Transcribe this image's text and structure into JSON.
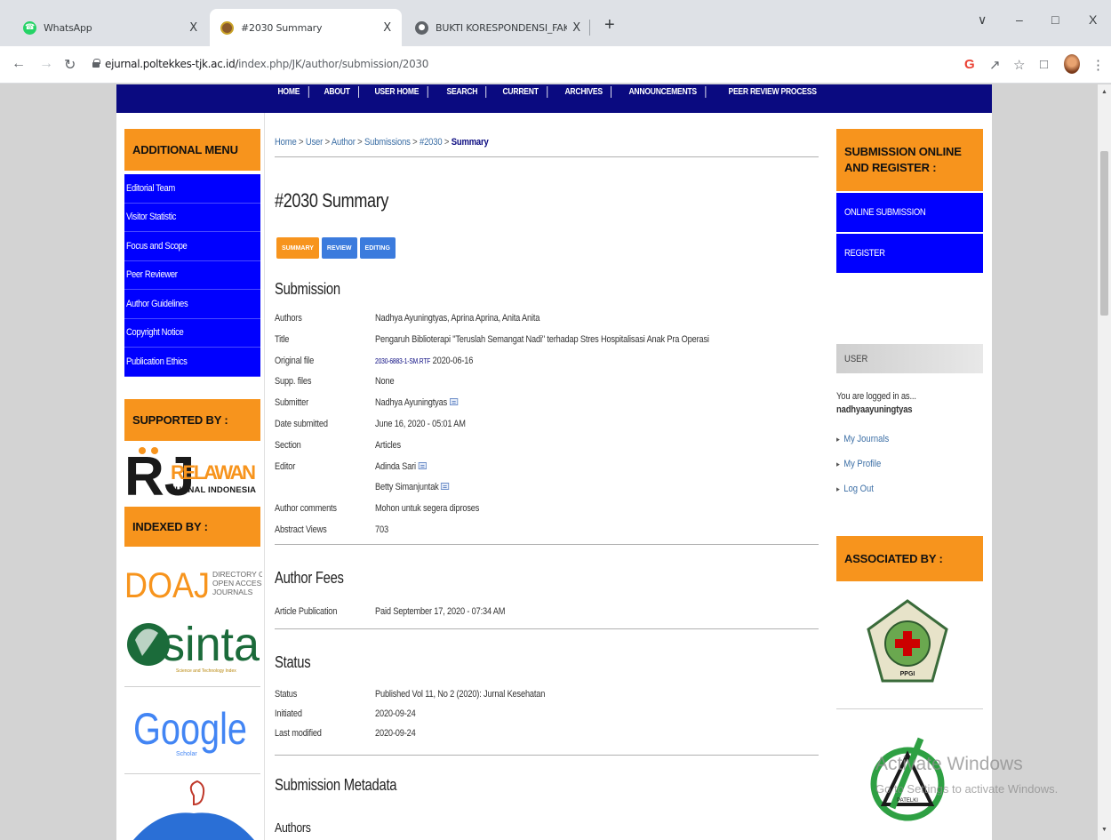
{
  "browser": {
    "tabs": [
      {
        "title": "WhatsApp",
        "close": "X",
        "icon": "whatsapp-icon"
      },
      {
        "title": "#2030 Summary",
        "close": "X",
        "icon": "site-favicon-icon"
      },
      {
        "title": "BUKTI KORESPONDENSI_FAKTO",
        "close": "X",
        "icon": "globe-icon"
      }
    ],
    "new_tab": "+",
    "window_controls": {
      "menu": "∨",
      "minimize": "–",
      "restore": "□",
      "close": "X"
    },
    "url_host": "ejurnal.poltekkes-tjk.ac.id/",
    "url_path": "index.php/JK/author/submission/2030"
  },
  "site": {
    "nav": [
      "HOME",
      "ABOUT",
      "USER HOME",
      "SEARCH",
      "CURRENT",
      "ARCHIVES",
      "ANNOUNCEMENTS",
      "PEER REVIEW PROCESS"
    ],
    "left": {
      "additional_menu": "ADDITIONAL MENU",
      "menu_items": [
        "Editorial Team",
        "Visitor Statistic",
        "Focus and Scope",
        "Peer Reviewer",
        "Author Guidelines",
        "Copyright Notice",
        "Publication Ethics"
      ],
      "supported_by": "SUPPORTED BY :",
      "indexed_by": "INDEXED BY :",
      "relawan": {
        "rj": "RJ",
        "relawan": "RELAWAN",
        "jurnal": "JURNAL INDONESIA"
      },
      "doaj": {
        "mark": "DOAJ",
        "line1": "DIRECTORY OF",
        "line2": "OPEN ACCESS",
        "line3": "JOURNALS"
      },
      "sinta": {
        "word": "sinta",
        "tag": "Science and Technology Index"
      },
      "google": {
        "word": "Google",
        "scholar": "Scholar"
      }
    },
    "right": {
      "submission_head": "SUBMISSION ONLINE AND REGISTER :",
      "online_submission": "ONLINE SUBMISSION",
      "register": "REGISTER",
      "user_head": "USER",
      "logged_in": "You are logged in as...",
      "username": "nadhyaayuningtyas",
      "links": [
        "My Journals",
        "My Profile",
        "Log Out"
      ],
      "associated_by": "ASSOCIATED BY :",
      "assoc_logo_text": "PPGI",
      "assoc_logo2_text": "PATELKI"
    },
    "breadcrumb": {
      "home": "Home",
      "user": "User",
      "author": "Author",
      "submissions": "Submissions",
      "id": "#2030",
      "current": "Summary",
      "sep": " > "
    },
    "title": "#2030 Summary",
    "subtabs": [
      "SUMMARY",
      "REVIEW",
      "EDITING"
    ],
    "submission": {
      "heading": "Submission",
      "rows": [
        {
          "k": "Authors",
          "v": "Nadhya Ayuningtyas, Aprina Aprina, Anita Anita"
        },
        {
          "k": "Title",
          "v": "Pengaruh Biblioterapi \"Teruslah Semangat Nadi\" terhadap Stres Hospitalisasi Anak Pra Operasi"
        },
        {
          "k": "Original file",
          "v": "2030-6883-1-SM.RTF",
          "v2": " 2020-06-16"
        },
        {
          "k": "Supp. files",
          "v": "None"
        },
        {
          "k": "Submitter",
          "v": "Nadhya Ayuningtyas"
        },
        {
          "k": "Date submitted",
          "v": "June 16, 2020 - 05:01 AM"
        },
        {
          "k": "Section",
          "v": "Articles"
        },
        {
          "k": "Editor",
          "v": "Adinda Sari"
        },
        {
          "k": "",
          "v": "Betty Simanjuntak"
        },
        {
          "k": "Author comments",
          "v": "Mohon untuk segera diproses"
        },
        {
          "k": "Abstract Views",
          "v": "703"
        }
      ]
    },
    "fees": {
      "heading": "Author Fees",
      "k": "Article Publication",
      "v": "Paid September 17, 2020 - 07:34 AM"
    },
    "status": {
      "heading": "Status",
      "rows": [
        {
          "k": "Status",
          "v": "Published   Vol 11, No 2 (2020): Jurnal Kesehatan"
        },
        {
          "k": "Initiated",
          "v": "2020-09-24"
        },
        {
          "k": "Last modified",
          "v": "2020-09-24"
        }
      ]
    },
    "metadata": {
      "heading": "Submission Metadata",
      "sub": "Authors"
    }
  },
  "watermark": {
    "line1": "Activate Windows",
    "line2": "Go to Settings to activate Windows."
  },
  "colors": {
    "nav": "#0a0a80",
    "orange": "#f7941d",
    "menu_blue": "#0000ff",
    "tab_blue": "#3b7bdd"
  }
}
